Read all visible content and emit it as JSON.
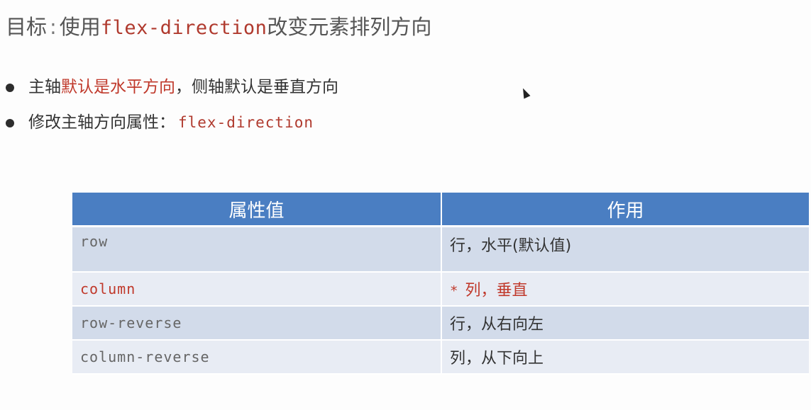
{
  "slide": {
    "title_prefix": "目标",
    "title_sep": ":",
    "title_action": "使用",
    "title_code": "flex-direction",
    "title_suffix": "改变元素排列方向"
  },
  "bullets": [
    {
      "parts": [
        {
          "text": "主轴",
          "highlight": false
        },
        {
          "text": "默认是水平方向",
          "highlight": true
        },
        {
          "text": "，侧轴默认是垂直方向",
          "highlight": false
        }
      ]
    },
    {
      "label": "修改主轴方向属性：",
      "code": "flex-direction"
    }
  ],
  "table": {
    "headers": [
      "属性值",
      "作用"
    ],
    "rows": [
      {
        "value": "row",
        "effect": "行，水平",
        "effect_note": "(默认值)",
        "highlight": false
      },
      {
        "value": "column",
        "effect": "列，垂直",
        "star": "*",
        "highlight": true
      },
      {
        "value": "row-reverse",
        "effect": "行，从右向左",
        "highlight": false
      },
      {
        "value": "column-reverse",
        "effect": "列，从下向上",
        "highlight": false
      }
    ]
  },
  "colors": {
    "header_bg": "#4a7ec2",
    "row_dark": "#d2dbea",
    "row_light": "#e8ecf4",
    "highlight_red": "#c0392b"
  },
  "icons": [
    "bullet-dot-icon",
    "mouse-cursor-icon"
  ]
}
